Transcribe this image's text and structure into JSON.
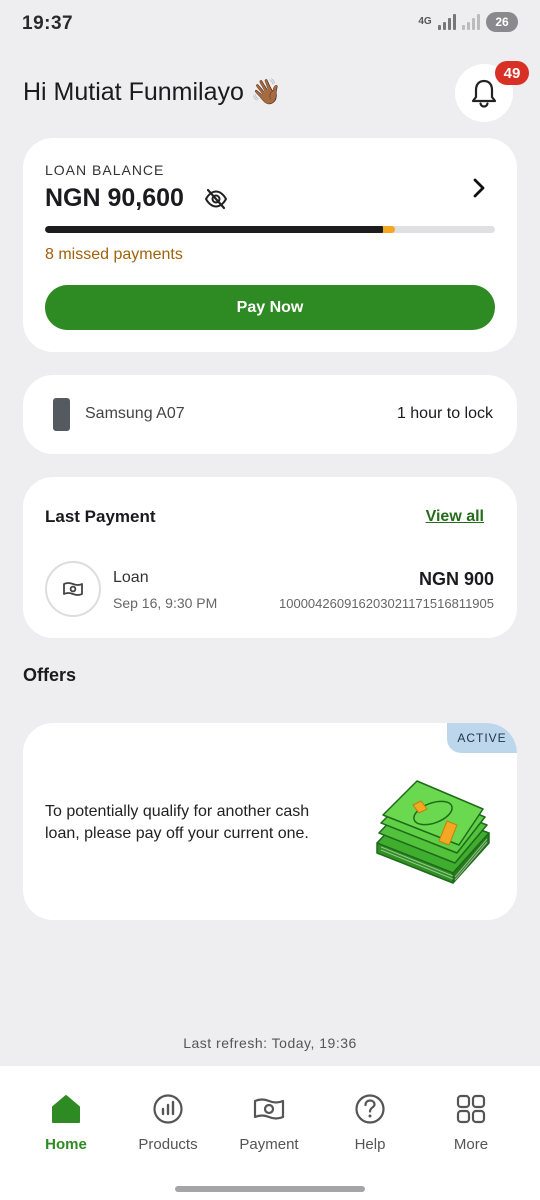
{
  "status_bar": {
    "time": "19:37",
    "network": "4G",
    "battery": "26"
  },
  "header": {
    "greeting": "Hi Mutiat Funmilayo 👋🏾",
    "notification_count": "49"
  },
  "loan": {
    "label": "LOAN BALANCE",
    "amount": "NGN 90,600",
    "progress_fraction": 0.755,
    "missed_payments": "8 missed payments",
    "pay_button": "Pay Now"
  },
  "device": {
    "name": "Samsung A07",
    "lock_status": "1 hour to lock"
  },
  "last_payment": {
    "title": "Last Payment",
    "view_all": "View all",
    "type": "Loan",
    "date": "Sep 16, 9:30 PM",
    "amount": "NGN 900",
    "reference": "100004260916203021171516811905"
  },
  "offers": {
    "title": "Offers",
    "badge": "ACTIVE",
    "text": "To potentially qualify for another cash loan, please pay off your current one."
  },
  "last_refresh": "Last refresh: Today, 19:36",
  "nav": {
    "items": [
      {
        "label": "Home",
        "icon": "home-icon",
        "active": true
      },
      {
        "label": "Products",
        "icon": "chart-icon",
        "active": false
      },
      {
        "label": "Payment",
        "icon": "money-icon",
        "active": false
      },
      {
        "label": "Help",
        "icon": "help-icon",
        "active": false
      },
      {
        "label": "More",
        "icon": "grid-icon",
        "active": false
      }
    ]
  },
  "colors": {
    "accent": "#2e8b23",
    "badge": "#d93025",
    "warning": "#a0620a"
  }
}
